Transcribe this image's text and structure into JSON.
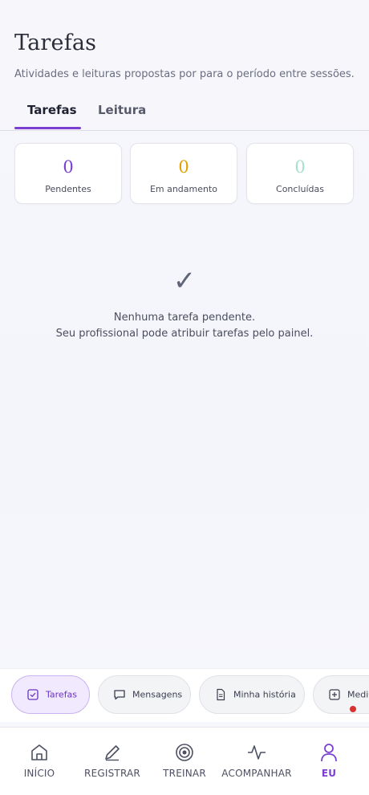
{
  "header": {
    "title": "Tarefas",
    "subtitle": "Atividades e leituras propostas por para o período entre sessões."
  },
  "tabs": [
    {
      "label": "Tarefas",
      "active": true
    },
    {
      "label": "Leitura",
      "active": false
    }
  ],
  "stats": [
    {
      "value": "0",
      "label": "Pendentes",
      "color": "#7b3fd1"
    },
    {
      "value": "0",
      "label": "Em andamento",
      "color": "#e0a100"
    },
    {
      "value": "0",
      "label": "Concluídas",
      "color": "#a8e0cf"
    }
  ],
  "empty_state": {
    "icon": "check-mark",
    "line1": "Nenhuma tarefa pendente.",
    "line2": "Seu profissional pode atribuir tarefas pelo painel."
  },
  "quick_bar": [
    {
      "label": "Tarefas",
      "icon": "checkbox-icon",
      "active": true
    },
    {
      "label": "Mensagens",
      "icon": "message-icon",
      "active": false
    },
    {
      "label": "Minha história",
      "icon": "document-icon",
      "active": false
    },
    {
      "label": "Medi",
      "icon": "plus-square-icon",
      "active": false
    }
  ],
  "bottom_nav": [
    {
      "label": "INÍCIO",
      "icon": "home-icon",
      "active": false
    },
    {
      "label": "REGISTRAR",
      "icon": "pen-icon",
      "active": false
    },
    {
      "label": "TREINAR",
      "icon": "target-icon",
      "active": false
    },
    {
      "label": "ACOMPANHAR",
      "icon": "activity-icon",
      "active": false
    },
    {
      "label": "EU",
      "icon": "user-icon",
      "active": true
    }
  ],
  "colors": {
    "accent": "#7b3fd1",
    "notification": "#d93030"
  }
}
